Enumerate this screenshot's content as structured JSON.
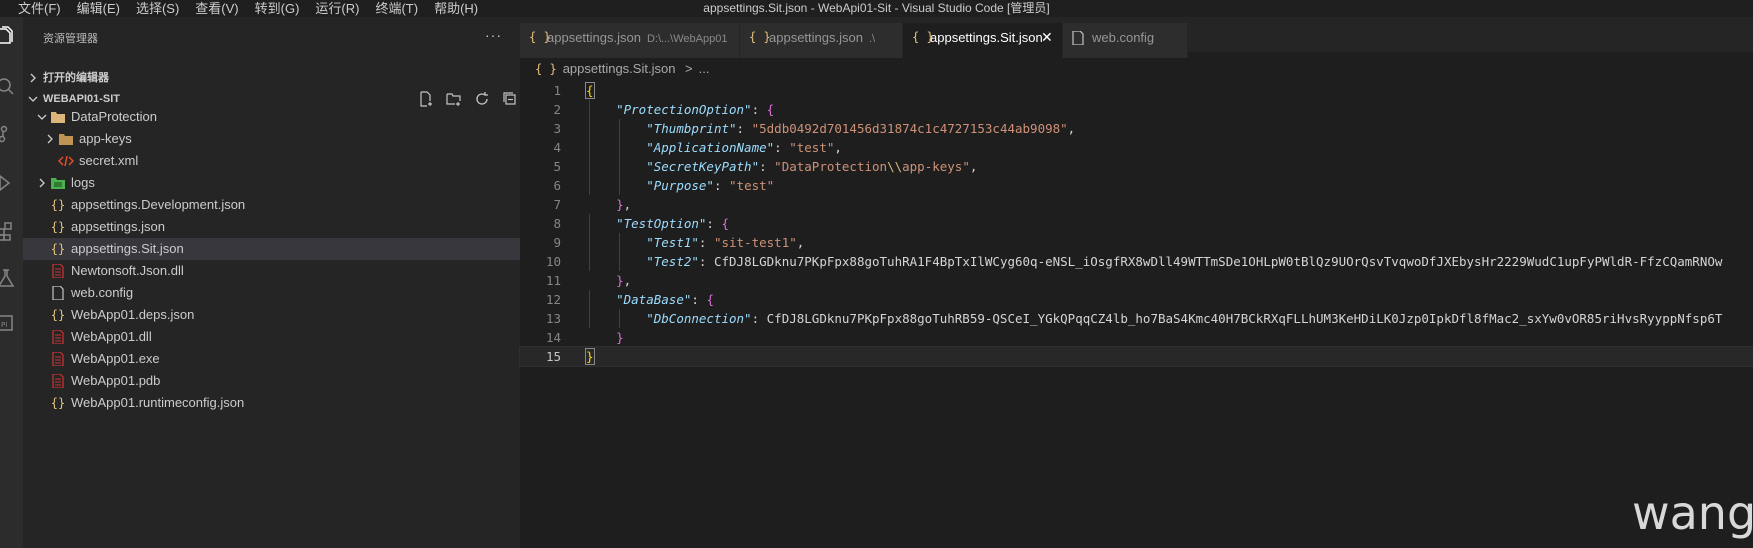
{
  "window": {
    "title": "appsettings.Sit.json - WebApi01-Sit - Visual Studio Code [管理员]"
  },
  "menu": [
    "文件(F)",
    "编辑(E)",
    "选择(S)",
    "查看(V)",
    "转到(G)",
    "运行(R)",
    "终端(T)",
    "帮助(H)"
  ],
  "sidebar": {
    "title": "资源管理器",
    "more": "···",
    "open_editors_label": "打开的编辑器",
    "project_label": "WEBAPI01-SIT",
    "tree": [
      {
        "name": "DataProtection",
        "kind": "folder-open",
        "depth": 0,
        "twisty": "open"
      },
      {
        "name": "app-keys",
        "kind": "folder",
        "depth": 1,
        "twisty": "closed"
      },
      {
        "name": "secret.xml",
        "kind": "xml",
        "depth": 1,
        "twisty": "none"
      },
      {
        "name": "logs",
        "kind": "folder-logs",
        "depth": 0,
        "twisty": "closed"
      },
      {
        "name": "appsettings.Development.json",
        "kind": "json",
        "depth": 0,
        "twisty": "none"
      },
      {
        "name": "appsettings.json",
        "kind": "json",
        "depth": 0,
        "twisty": "none"
      },
      {
        "name": "appsettings.Sit.json",
        "kind": "json",
        "depth": 0,
        "twisty": "none",
        "selected": true
      },
      {
        "name": "Newtonsoft.Json.dll",
        "kind": "binary",
        "depth": 0,
        "twisty": "none"
      },
      {
        "name": "web.config",
        "kind": "file",
        "depth": 0,
        "twisty": "none"
      },
      {
        "name": "WebApp01.deps.json",
        "kind": "json",
        "depth": 0,
        "twisty": "none"
      },
      {
        "name": "WebApp01.dll",
        "kind": "binary",
        "depth": 0,
        "twisty": "none"
      },
      {
        "name": "WebApp01.exe",
        "kind": "binary",
        "depth": 0,
        "twisty": "none"
      },
      {
        "name": "WebApp01.pdb",
        "kind": "binary",
        "depth": 0,
        "twisty": "none"
      },
      {
        "name": "WebApp01.runtimeconfig.json",
        "kind": "json",
        "depth": 0,
        "twisty": "none"
      }
    ]
  },
  "tabs": [
    {
      "name": "appsettings.json",
      "desc": "D:\\...\\WebApp01",
      "kind": "json",
      "active": false
    },
    {
      "name": "appsettings.json",
      "desc": ".\\",
      "kind": "json",
      "active": false
    },
    {
      "name": "appsettings.Sit.json",
      "desc": "",
      "kind": "json",
      "active": true,
      "close": "✕"
    },
    {
      "name": "web.config",
      "desc": "",
      "kind": "file",
      "active": false
    }
  ],
  "breadcrumb": {
    "file": "appsettings.Sit.json",
    "sep": ">",
    "rest": "..."
  },
  "editor": {
    "current_line": 15,
    "lines": [
      "{",
      "    \"ProtectionOption\": {",
      "        \"Thumbprint\": \"5ddb0492d701456d31874c1c4727153c44ab9098\",",
      "        \"ApplicationName\": \"test\",",
      "        \"SecretKeyPath\": \"DataProtection\\\\app-keys\",",
      "        \"Purpose\": \"test\"",
      "    },",
      "    \"TestOption\": {",
      "        \"Test1\": \"sit-test1\",",
      "        \"Test2\": \"CfDJ8LGDknu7PKpFpx88goTuhRA1F4BpTxIlWCyg60q-eNSL_iOsgfRX8wDll49WTTmSDe1OHLpW0tBlQz9UOrQsvTvqwoDfJXEbysHr2229WudC1upFyPWldR-FfzCQamRNOw",
      "    },",
      "    \"DataBase\": {",
      "        \"DbConnection\": \"CfDJ8LGDknu7PKpFpx88goTuhRB59-QSCeI_YGkQPqqCZ4lb_ho7BaS4Kmc40H7BCkRXqFLLhUM3KeHDiLK0Jzp0IpkDfl8fMac2_sxYw0vOR85riHvsRyyppNfsp6T",
      "    }",
      "}"
    ]
  },
  "watermark": "wang",
  "colors": {
    "accent": "#007acc",
    "keyword": "#9cdcfe",
    "string": "#ce9178"
  }
}
